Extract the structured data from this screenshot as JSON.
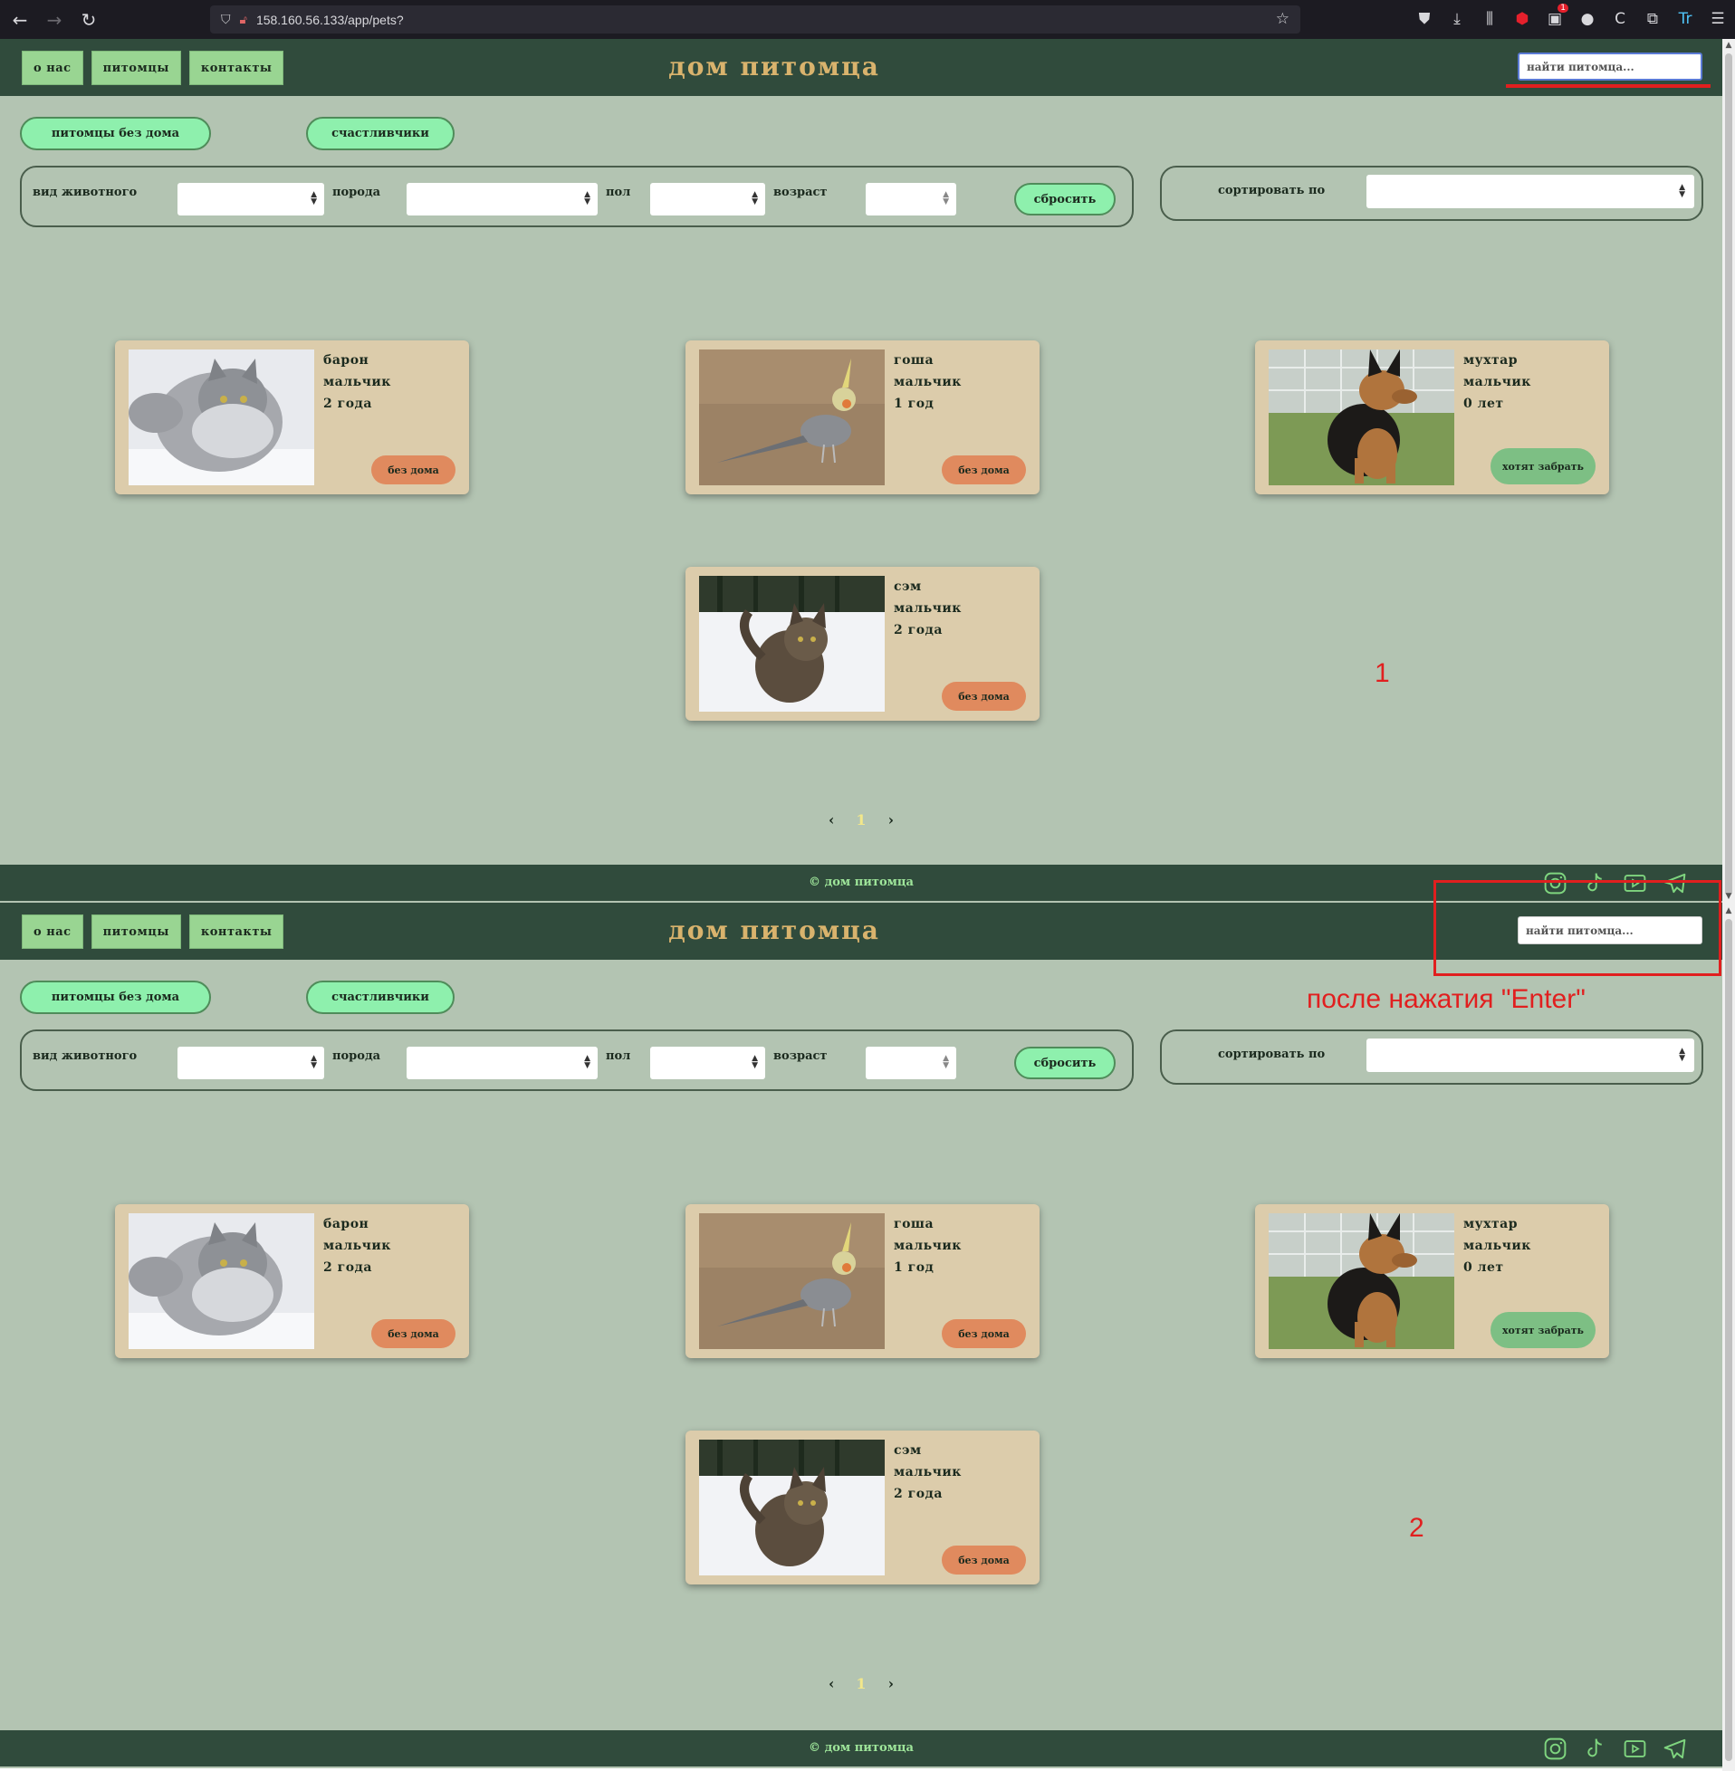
{
  "browser": {
    "url": "158.160.56.133/app/pets?",
    "tool_icons": [
      "pocket-icon",
      "download-icon",
      "library-icon",
      "ublock-icon",
      "extension-badge-icon",
      "globe-icon",
      "c-icon",
      "extensions-icon",
      "translate-icon",
      "menu-icon"
    ],
    "badge_count": "1"
  },
  "site": {
    "title": "дом питомца",
    "nav": [
      "о нас",
      "питомцы",
      "контакты"
    ],
    "search_placeholder": "найти питомца...",
    "tabs": [
      "питомцы без дома",
      "счастливчики"
    ],
    "filters": {
      "species_label": "вид животного",
      "breed_label": "порода",
      "sex_label": "пол",
      "age_label": "возраст",
      "reset_label": "сбросить"
    },
    "sort_label": "сортировать по",
    "pets": [
      {
        "name": "барон",
        "sex": "мальчик",
        "age": "2 года",
        "status": "без дома",
        "status_type": "homeless",
        "photo": "gray-fluffy-cat"
      },
      {
        "name": "гоша",
        "sex": "мальчик",
        "age": "1 год",
        "status": "без дома",
        "status_type": "homeless",
        "photo": "cockatiel-parrot"
      },
      {
        "name": "мухтар",
        "sex": "мальчик",
        "age": "0 лет",
        "status": "хотят забрать",
        "status_type": "wanted",
        "photo": "german-shepherd-puppy"
      },
      {
        "name": "сэм",
        "sex": "мальчик",
        "age": "2 года",
        "status": "без дома",
        "status_type": "homeless",
        "photo": "tabby-cat-in-snow"
      }
    ],
    "pager": {
      "prev": "‹",
      "current": "1",
      "next": "›"
    },
    "footer": "© дом питомца",
    "social_icons": [
      "instagram-icon",
      "tiktok-icon",
      "youtube-icon",
      "telegram-icon"
    ]
  },
  "annotations": {
    "label_1": "1",
    "label_2": "2",
    "enter_note": "после нажатия \"Enter\"",
    "color": "#e11f1f"
  },
  "colors": {
    "header": "#304b3c",
    "page_bg": "#b3c4b2",
    "title": "#d9b36d",
    "card": "#dcccab",
    "homeless_badge": "#e08a5e",
    "wanted_badge": "#7dbf84",
    "tab_button": "#8ef0ad"
  }
}
